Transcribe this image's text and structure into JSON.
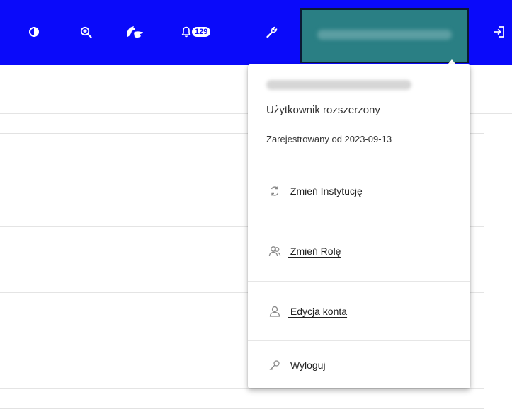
{
  "topbar": {
    "bg_color": "#0a0afa",
    "icons": [
      "contrast-icon",
      "zoom-in-icon",
      "sign-language-icon",
      "bell-icon",
      "wrench-icon",
      "logout-icon"
    ],
    "notifications_count": "129"
  },
  "user_menu": {
    "accent_color": "#2a7f84",
    "role": "Użytkownik rozszerzony",
    "registered": "Zarejestrowany od 2023-09-13",
    "items": [
      {
        "label": " Zmień Instytucję",
        "icon": "refresh-icon"
      },
      {
        "label": " Zmień Rolę",
        "icon": "users-icon"
      },
      {
        "label": " Edycja konta",
        "icon": "user-icon"
      },
      {
        "label": " Wyloguj",
        "icon": "key-icon"
      }
    ]
  }
}
